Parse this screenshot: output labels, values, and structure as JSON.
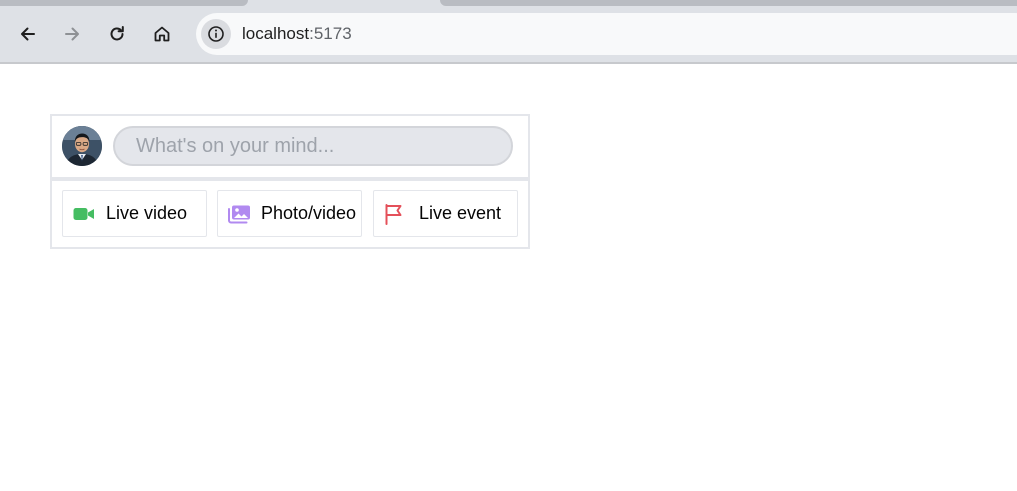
{
  "browser": {
    "url_host": "localhost",
    "url_port": ":5173",
    "icons": {
      "back": "arrow-left-icon",
      "forward": "arrow-right-icon",
      "reload": "reload-icon",
      "home": "home-icon",
      "site_info": "info-icon"
    }
  },
  "composer": {
    "placeholder": "What's on your mind...",
    "actions": [
      {
        "label": "Live video",
        "icon": "video-camera-icon",
        "color": "#45bd62"
      },
      {
        "label": "Photo/video",
        "icon": "photo-icon",
        "color": "#b18af0"
      },
      {
        "label": "Live event",
        "icon": "flag-icon",
        "color": "#e4505a"
      }
    ]
  }
}
